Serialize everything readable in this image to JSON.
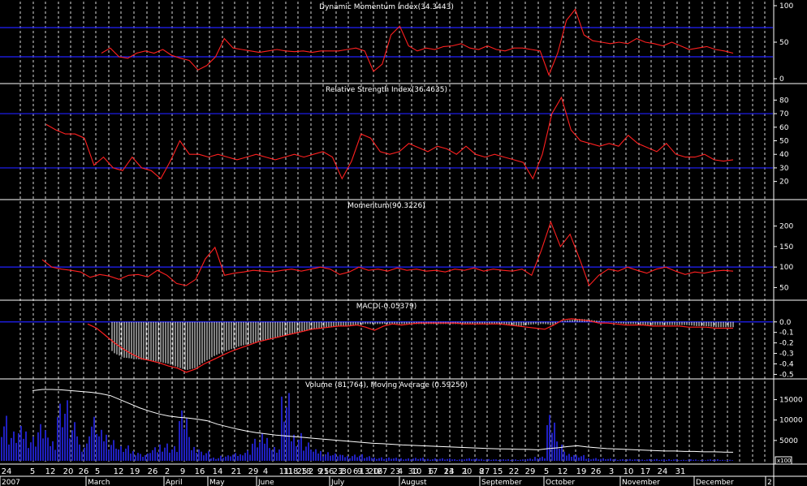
{
  "colors": {
    "background": "#000000",
    "grid": "#ffffff",
    "reference_line": "#2020ff",
    "indicator_line": "#ff2020",
    "volume_bar": "#2020c0",
    "histogram_bar": "#ffffff",
    "moving_average": "#ffffff"
  },
  "chart_data": [
    {
      "type": "line",
      "title": "Dynamic Momentum Index(34.3443)",
      "yticks": [
        "0",
        "50",
        "100"
      ],
      "ylim": [
        0,
        100
      ],
      "reference_lines": [
        30,
        70
      ],
      "series": [
        {
          "values": [
            35,
            42,
            30,
            28,
            35,
            38,
            35,
            40,
            32,
            28,
            25,
            12,
            18,
            30,
            55,
            42,
            40,
            38,
            36,
            38,
            40,
            38,
            37,
            38,
            36,
            38,
            38,
            38,
            40,
            42,
            38,
            10,
            20,
            60,
            72,
            45,
            38,
            42,
            40,
            44,
            45,
            48,
            42,
            40,
            45,
            40,
            38,
            42,
            42,
            40,
            38,
            5,
            35,
            80,
            95,
            60,
            52,
            50,
            48,
            50,
            48,
            55,
            50,
            48,
            45,
            50,
            45,
            40,
            42,
            44,
            40,
            38,
            35
          ]
        }
      ]
    },
    {
      "type": "line",
      "title": "Relative Strength Index(36.4635)",
      "yticks": [
        "20",
        "30",
        "40",
        "50",
        "60",
        "70",
        "80"
      ],
      "ylim": [
        15,
        85
      ],
      "reference_lines": [
        30,
        70
      ],
      "series": [
        {
          "values": [
            62,
            58,
            55,
            55,
            52,
            32,
            38,
            30,
            28,
            38,
            30,
            28,
            22,
            35,
            50,
            40,
            40,
            38,
            40,
            38,
            36,
            38,
            40,
            38,
            36,
            38,
            40,
            38,
            40,
            42,
            38,
            22,
            35,
            55,
            52,
            42,
            40,
            42,
            48,
            45,
            42,
            46,
            44,
            40,
            46,
            40,
            38,
            40,
            38,
            36,
            34,
            22,
            40,
            70,
            82,
            58,
            50,
            48,
            46,
            48,
            46,
            54,
            48,
            45,
            42,
            48,
            40,
            38,
            38,
            40,
            36,
            35,
            36
          ]
        }
      ]
    },
    {
      "type": "line",
      "title": "Momentum(90.3226)",
      "yticks": [
        "50",
        "100",
        "150",
        "200"
      ],
      "ylim": [
        35,
        225
      ],
      "reference_lines": [
        100
      ],
      "series": [
        {
          "values": [
            118,
            100,
            95,
            92,
            88,
            75,
            82,
            78,
            70,
            80,
            82,
            76,
            92,
            80,
            60,
            55,
            70,
            120,
            148,
            80,
            85,
            88,
            92,
            90,
            88,
            92,
            95,
            90,
            95,
            100,
            95,
            82,
            88,
            100,
            92,
            95,
            90,
            98,
            92,
            95,
            90,
            92,
            88,
            95,
            92,
            98,
            90,
            95,
            92,
            90,
            95,
            80,
            140,
            210,
            150,
            180,
            120,
            55,
            80,
            95,
            90,
            100,
            92,
            85,
            95,
            100,
            90,
            82,
            88,
            85,
            90,
            92,
            90
          ]
        }
      ]
    },
    {
      "type": "bar",
      "title": "MACD(-0.05379)",
      "yticks": [
        "0.0",
        "-0.1",
        "-0.2",
        "-0.3",
        "-0.4",
        "-0.5"
      ],
      "ylim": [
        -0.52,
        0.06
      ],
      "reference_lines": [
        0
      ],
      "series": [
        {
          "values": [
            -0.05,
            -0.12,
            -0.22,
            -0.3,
            -0.34,
            -0.35,
            -0.36,
            -0.37,
            -0.38,
            -0.4,
            -0.43,
            -0.46,
            -0.44,
            -0.38,
            -0.33,
            -0.29,
            -0.26,
            -0.23,
            -0.21,
            -0.19,
            -0.17,
            -0.15,
            -0.13,
            -0.11,
            -0.09,
            -0.07,
            -0.06,
            -0.05,
            -0.04,
            -0.04,
            -0.03,
            -0.02,
            -0.02,
            -0.02,
            -0.02,
            -0.02,
            -0.02,
            -0.02,
            -0.02,
            -0.02,
            -0.02,
            -0.02,
            -0.02,
            -0.02,
            -0.02,
            -0.02,
            -0.02,
            -0.03,
            -0.04,
            -0.03,
            -0.02,
            -0.02,
            -0.03,
            0.01,
            0.02,
            0.03,
            0.02,
            0.01,
            0.0,
            -0.01,
            -0.02,
            -0.02,
            -0.03,
            -0.03,
            -0.03,
            -0.03,
            -0.03,
            -0.03,
            -0.04,
            -0.04,
            -0.05,
            -0.05,
            -0.05
          ]
        },
        {
          "values": [
            -0.02,
            -0.06,
            -0.13,
            -0.2,
            -0.26,
            -0.31,
            -0.35,
            -0.37,
            -0.39,
            -0.42,
            -0.44,
            -0.48,
            -0.45,
            -0.4,
            -0.36,
            -0.32,
            -0.28,
            -0.25,
            -0.22,
            -0.19,
            -0.17,
            -0.15,
            -0.13,
            -0.11,
            -0.09,
            -0.07,
            -0.06,
            -0.05,
            -0.04,
            -0.04,
            -0.03,
            -0.05,
            -0.08,
            -0.04,
            -0.02,
            -0.03,
            -0.02,
            -0.01,
            -0.01,
            -0.01,
            -0.01,
            -0.01,
            -0.02,
            -0.02,
            -0.02,
            -0.02,
            -0.02,
            -0.03,
            -0.04,
            -0.05,
            -0.06,
            -0.07,
            -0.03,
            0.02,
            0.03,
            0.02,
            0.01,
            -0.01,
            -0.01,
            -0.02,
            -0.03,
            -0.03,
            -0.03,
            -0.04,
            -0.04,
            -0.04,
            -0.04,
            -0.05,
            -0.05,
            -0.05,
            -0.06,
            -0.06,
            -0.06
          ]
        }
      ]
    },
    {
      "type": "bar",
      "title": "Volume (81,764), Moving Average (0.59250)",
      "yticks": [
        "5000",
        "10000",
        "15000"
      ],
      "ylim": [
        0,
        18500
      ],
      "unit_label": "x100",
      "series": [
        {
          "values": [
            13000,
            8000,
            9000,
            7000,
            10000,
            6000,
            16500,
            10000,
            5000,
            12000,
            8000,
            6000,
            4000,
            3000,
            2000,
            3500,
            5000,
            4000,
            13000,
            4000,
            2500,
            1000,
            1500,
            2000,
            3000,
            6000,
            7000,
            4000,
            17500,
            8000,
            5000,
            3000,
            2500,
            2000,
            1500,
            1800,
            1200,
            1000,
            900,
            800,
            700,
            800,
            600,
            700,
            600,
            500,
            700,
            600,
            500,
            400,
            500,
            400,
            600,
            1200,
            12500,
            5000,
            2000,
            1500,
            800,
            700,
            600,
            500,
            500,
            400,
            500,
            400,
            500,
            300,
            400,
            300,
            400,
            300,
            300
          ]
        },
        {
          "values": [
            17200,
            17500,
            17500,
            17400,
            17200,
            17000,
            16800,
            16500,
            16000,
            15000,
            14000,
            13000,
            12200,
            11500,
            11000,
            10700,
            10500,
            10200,
            9800,
            9000,
            8400,
            7800,
            7300,
            6900,
            6600,
            6300,
            6100,
            5900,
            5700,
            5500,
            5300,
            5100,
            4900,
            4700,
            4500,
            4300,
            4200,
            4050,
            3900,
            3800,
            3700,
            3600,
            3500,
            3400,
            3300,
            3200,
            3100,
            3000,
            2950,
            2900,
            2850,
            2800,
            2700,
            3000,
            3200,
            3500,
            3700,
            3400,
            3200,
            3000,
            2900,
            2800,
            2700,
            2600,
            2500,
            2400,
            2400,
            2300,
            2300,
            2200,
            2200,
            2150,
            2100
          ]
        }
      ]
    }
  ],
  "x_axis": {
    "day_labels": [
      "24",
      "5",
      "12",
      "20",
      "26",
      "5",
      "12",
      "19",
      "26",
      "2",
      "9",
      "16",
      "14",
      "21",
      "29",
      "4",
      "11",
      "18",
      "25",
      "2",
      "9",
      "16",
      "23",
      "30",
      "6",
      "13",
      "20",
      "27",
      "4",
      "10",
      "17",
      "24",
      "1",
      "8",
      "15",
      "22",
      "29",
      "5",
      "12",
      "19",
      "26",
      "3",
      "10",
      "17",
      "24",
      "31"
    ],
    "overlap_labels": [
      "11",
      "18",
      "25",
      "2",
      "9",
      "16",
      "23",
      "30",
      "6",
      "13",
      "20",
      "27"
    ],
    "month_labels": [
      "2007",
      "March",
      "April",
      "May",
      "June",
      "July",
      "August",
      "September",
      "October",
      "November",
      "December",
      "2"
    ]
  }
}
